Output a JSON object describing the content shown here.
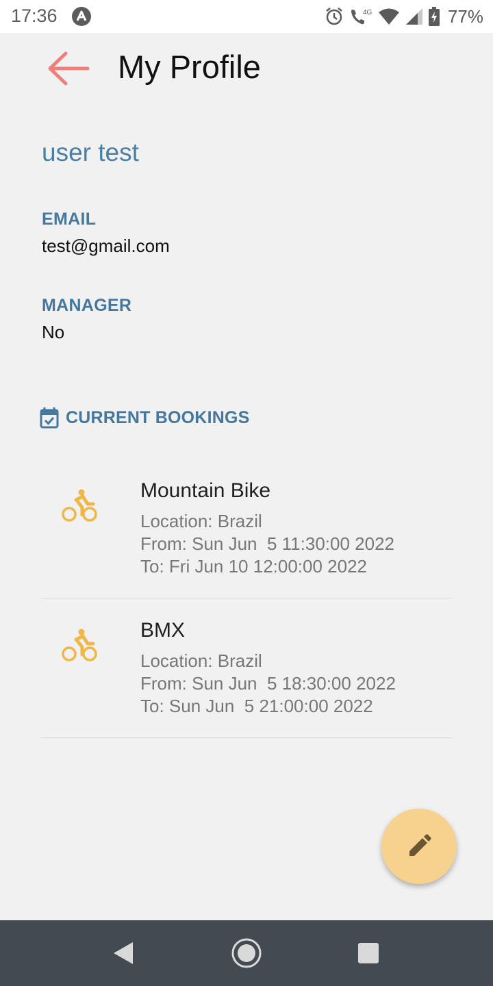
{
  "status_bar": {
    "time": "17:36",
    "battery": "77%",
    "network": "4G",
    "icons": [
      "alarm-icon",
      "call-icon",
      "wifi-icon",
      "signal-icon",
      "battery-icon"
    ]
  },
  "header": {
    "title": "My Profile",
    "back_icon": "arrow-back-icon",
    "back_color": "#f07e7b"
  },
  "profile": {
    "name": "user test",
    "fields": [
      {
        "label": "EMAIL",
        "value": "test@gmail.com"
      },
      {
        "label": "MANAGER",
        "value": "No"
      }
    ]
  },
  "bookings": {
    "section_label": "CURRENT BOOKINGS",
    "section_icon": "calendar-check-icon",
    "items": [
      {
        "name": "Mountain Bike",
        "location": "Location: Brazil",
        "from": "From: Sun Jun  5 11:30:00 2022",
        "to": "To: Fri Jun 10 12:00:00 2022",
        "icon": "bike-icon"
      },
      {
        "name": "BMX",
        "location": "Location: Brazil",
        "from": "From: Sun Jun  5 18:30:00 2022",
        "to": "To: Sun Jun  5 21:00:00 2022",
        "icon": "bike-icon"
      }
    ]
  },
  "fab": {
    "icon": "pencil-icon",
    "color": "#f7d28e"
  },
  "colors": {
    "accent": "#4a7fa4",
    "bike_icon": "#f0b648",
    "background": "#f1f1f1",
    "navbar": "#434a51"
  }
}
